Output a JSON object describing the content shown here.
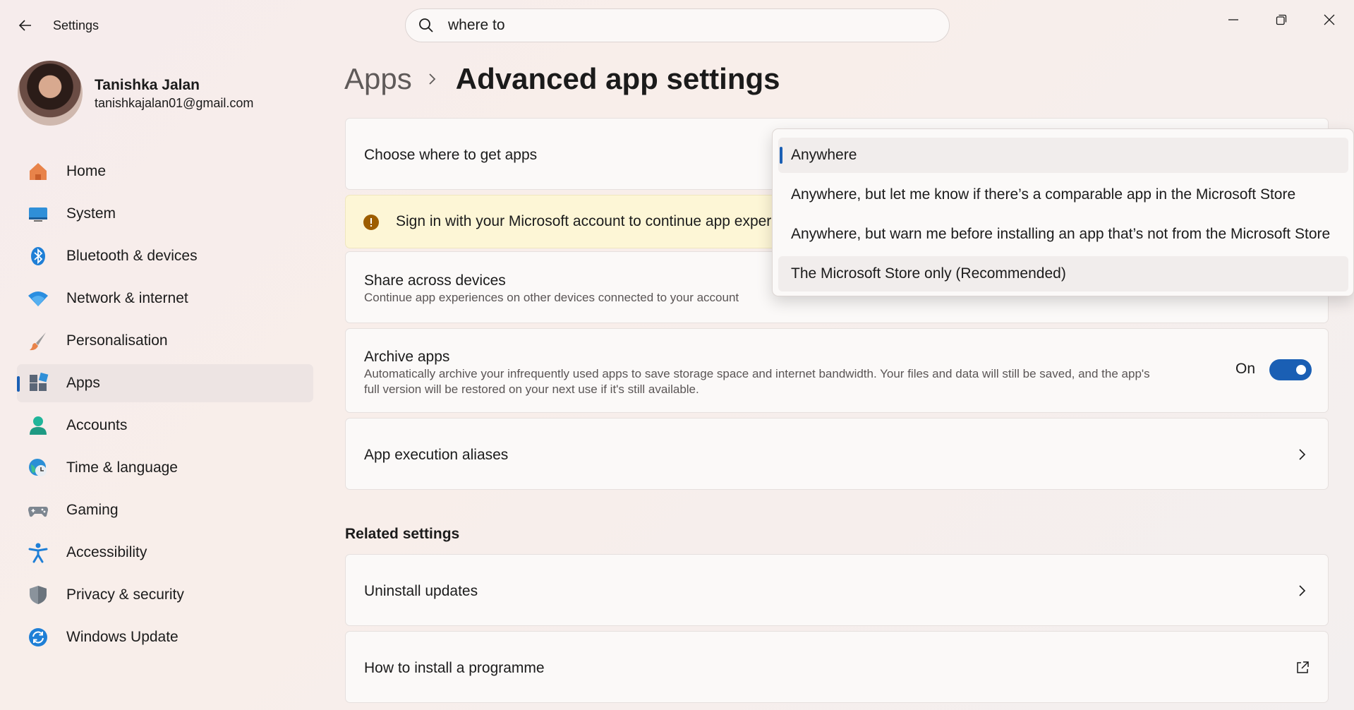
{
  "window": {
    "title": "Settings",
    "controls": [
      "minimize-icon",
      "maximize-icon",
      "close-icon"
    ]
  },
  "search": {
    "value": "where to",
    "icon": "search-icon"
  },
  "profile": {
    "name": "Tanishka Jalan",
    "email": "tanishkajalan01@gmail.com"
  },
  "sidebar": {
    "selected": "Apps",
    "items": [
      {
        "label": "Home",
        "icon": "home-icon"
      },
      {
        "label": "System",
        "icon": "monitor-icon"
      },
      {
        "label": "Bluetooth & devices",
        "icon": "bluetooth-icon"
      },
      {
        "label": "Network & internet",
        "icon": "wifi-icon"
      },
      {
        "label": "Personalisation",
        "icon": "brush-icon"
      },
      {
        "label": "Apps",
        "icon": "apps-icon"
      },
      {
        "label": "Accounts",
        "icon": "person-icon"
      },
      {
        "label": "Time & language",
        "icon": "globe-clock-icon"
      },
      {
        "label": "Gaming",
        "icon": "gamepad-icon"
      },
      {
        "label": "Accessibility",
        "icon": "accessibility-icon"
      },
      {
        "label": "Privacy & security",
        "icon": "shield-icon"
      },
      {
        "label": "Windows Update",
        "icon": "update-icon"
      }
    ]
  },
  "breadcrumb": {
    "parent": "Apps",
    "current": "Advanced app settings"
  },
  "main": {
    "choose_apps": {
      "title": "Choose where to get apps"
    },
    "warning": {
      "text": "Sign in with your Microsoft account to continue app exper",
      "icon": "warning-icon"
    },
    "share": {
      "title": "Share across devices",
      "description": "Continue app experiences on other devices connected to your account"
    },
    "archive": {
      "title": "Archive apps",
      "description_line1": "Automatically archive your infrequently used apps to save storage space and internet bandwidth. Your files and data will still be saved, and the app's",
      "description_line2": "full version will be restored on your next use if it's still available.",
      "toggle_label": "On",
      "toggle_on": true
    },
    "aliases": {
      "title": "App execution aliases"
    },
    "related_heading": "Related settings",
    "uninstall": {
      "title": "Uninstall updates"
    },
    "install": {
      "title": "How to install a programme"
    }
  },
  "dropdown": {
    "selected_index": 0,
    "options": [
      "Anywhere",
      "Anywhere, but let me know if there’s a comparable app in the Microsoft Store",
      "Anywhere, but warn me before installing an app that’s not from the Microsoft Store",
      "The Microsoft Store only (Recommended)"
    ]
  },
  "colors": {
    "accent": "#1a5fb4",
    "warning_bg": "#fdf6d6",
    "warning_icon": "#9d5d00"
  }
}
